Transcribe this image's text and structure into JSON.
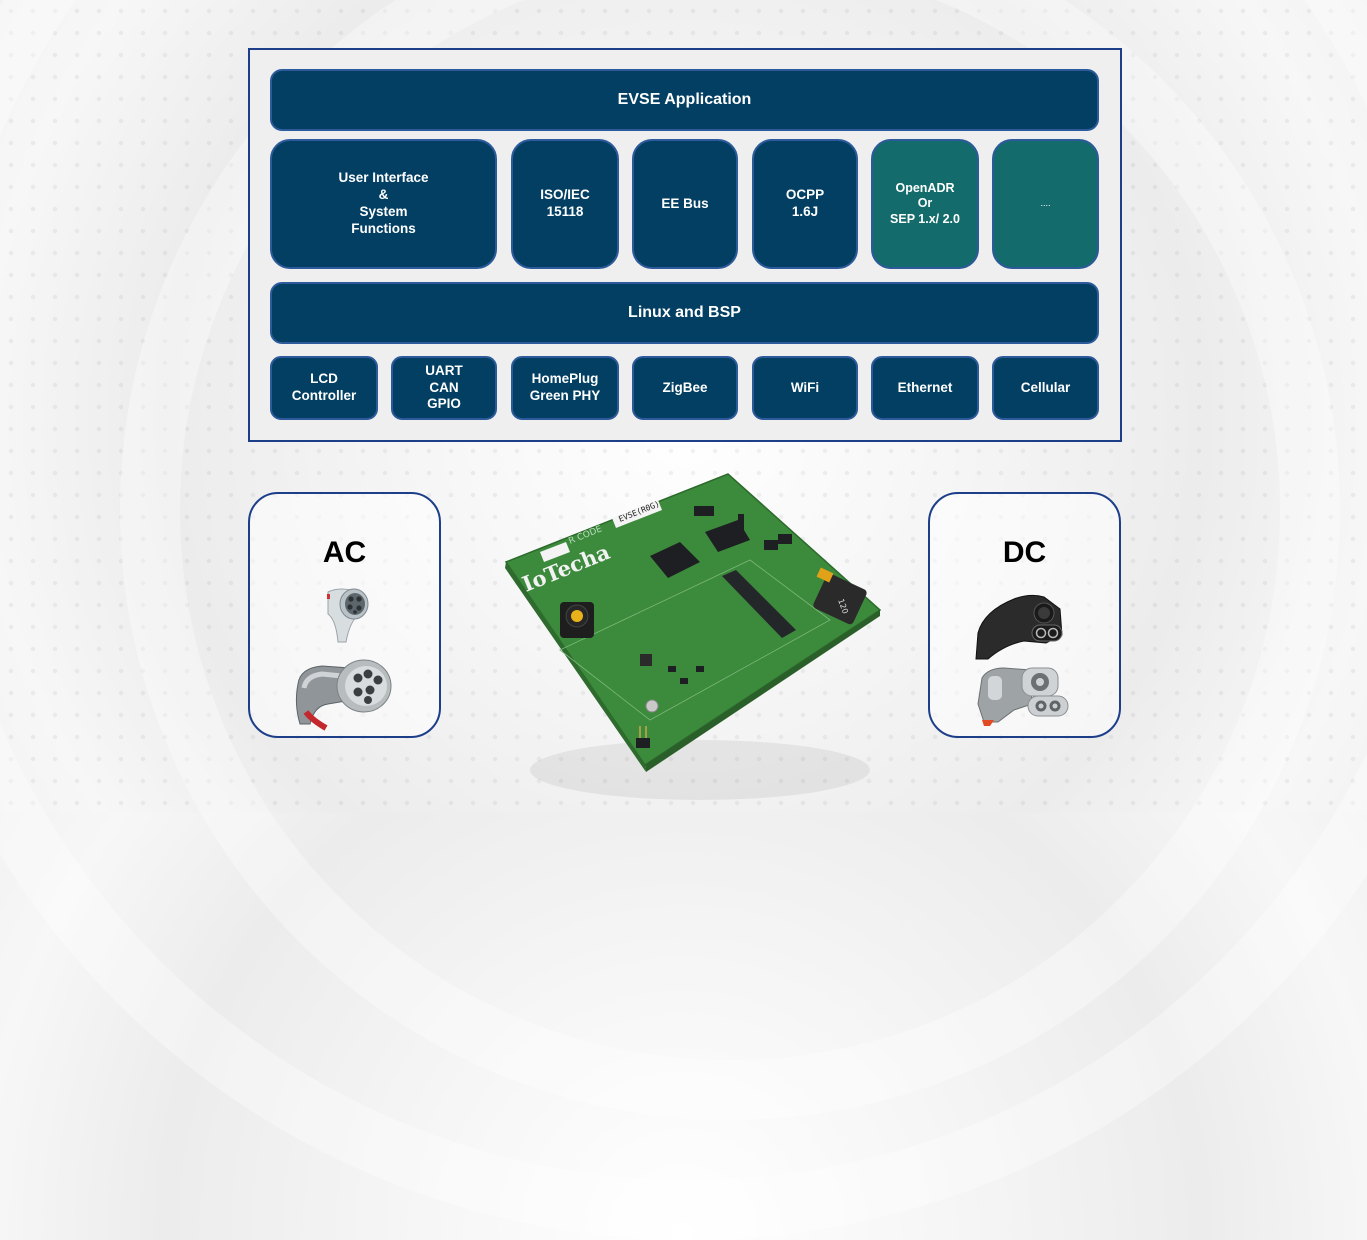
{
  "diagram": {
    "title_bar": "EVSE Application",
    "application_modules": [
      {
        "label": "User Interface\n&\nSystem\nFunctions",
        "color": "#023f63"
      },
      {
        "label": "ISO/IEC\n15118",
        "color": "#023f63"
      },
      {
        "label": "EE Bus",
        "color": "#023f63"
      },
      {
        "label": "OCPP\n1.6J",
        "color": "#023f63"
      },
      {
        "label": "OpenADR\nOr\nSEP 1.x/ 2.0",
        "color": "#146b6b"
      },
      {
        "label": "....",
        "color": "#146b6b"
      }
    ],
    "os_bar": "Linux and BSP",
    "interfaces": [
      {
        "label": "LCD\nController"
      },
      {
        "label": "UART\nCAN\nGPIO"
      },
      {
        "label": "HomePlug\nGreen PHY"
      },
      {
        "label": "ZigBee"
      },
      {
        "label": "WiFi"
      },
      {
        "label": "Ethernet"
      },
      {
        "label": "Cellular"
      }
    ]
  },
  "connectors": {
    "ac": {
      "title": "AC",
      "plugs": [
        "type1-connector",
        "type2-connector"
      ]
    },
    "dc": {
      "title": "DC",
      "plugs": [
        "chademo-connector",
        "ccs-combo-connector"
      ]
    }
  },
  "board": {
    "brand": "IoTecha",
    "label": "EVSE(R0G)",
    "qr_text": "R CODE",
    "inductor_marking": "120"
  },
  "colors": {
    "navy": "#023f63",
    "teal": "#146b6b",
    "frame_border": "#1d3f8a",
    "pcb_green": "#3c8a3c"
  }
}
